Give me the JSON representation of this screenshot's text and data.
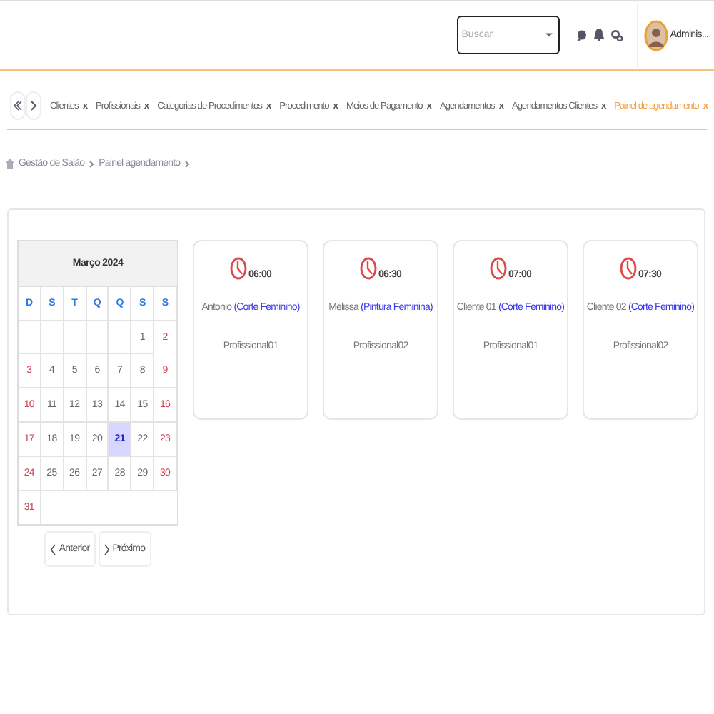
{
  "topbar": {
    "search": {
      "placeholder": "Buscar"
    },
    "user": "Adminis..."
  },
  "tabs": [
    {
      "label": "Clientes",
      "close": "x",
      "selected": false
    },
    {
      "label": "Profissionais",
      "close": "x",
      "selected": false
    },
    {
      "label": "Categorias de Procedimentos",
      "close": "x",
      "selected": false
    },
    {
      "label": "Procedimento",
      "close": "x",
      "selected": false
    },
    {
      "label": "Meios de Pagamento",
      "close": "x",
      "selected": false
    },
    {
      "label": "Agendamentos",
      "close": "x",
      "selected": false
    },
    {
      "label": "Agendamentos Clientes",
      "close": "x",
      "selected": false
    },
    {
      "label": "Painel de agendamento",
      "close": "x",
      "selected": true
    }
  ],
  "breadcrumb": [
    "Gestão de Salão",
    "Painel agendamento"
  ],
  "calendar": {
    "title": "Março 2024",
    "weekdays": [
      "D",
      "S",
      "T",
      "Q",
      "Q",
      "S",
      "S"
    ],
    "weeks": [
      [
        {
          "day": "1",
          "selected": false
        },
        {
          "day": "2",
          "selected": false
        }
      ],
      [
        {
          "day": "3",
          "selected": false
        },
        {
          "day": "4",
          "selected": false
        },
        {
          "day": "5",
          "selected": false
        },
        {
          "day": "6",
          "selected": false
        },
        {
          "day": "7",
          "selected": false
        },
        {
          "day": "8",
          "selected": false
        },
        {
          "day": "9",
          "selected": false
        }
      ],
      [
        {
          "day": "10",
          "selected": false
        },
        {
          "day": "11",
          "selected": false
        },
        {
          "day": "12",
          "selected": false
        },
        {
          "day": "13",
          "selected": false
        },
        {
          "day": "14",
          "selected": false
        },
        {
          "day": "15",
          "selected": false
        },
        {
          "day": "16",
          "selected": false
        }
      ],
      [
        {
          "day": "17",
          "selected": false
        },
        {
          "day": "18",
          "selected": false
        },
        {
          "day": "19",
          "selected": false
        },
        {
          "day": "20",
          "selected": false
        },
        {
          "day": "21",
          "selected": true
        },
        {
          "day": "22",
          "selected": false
        },
        {
          "day": "23",
          "selected": false
        }
      ],
      [
        {
          "day": "24",
          "selected": false
        },
        {
          "day": "25",
          "selected": false
        },
        {
          "day": "26",
          "selected": false
        },
        {
          "day": "27",
          "selected": false
        },
        {
          "day": "28",
          "selected": false
        },
        {
          "day": "29",
          "selected": false
        },
        {
          "day": "30",
          "selected": false
        }
      ],
      [
        {
          "day": "31",
          "selected": false
        }
      ]
    ],
    "prev": "Anterior",
    "next": "Próximo"
  },
  "appointments": [
    {
      "time": "06:00",
      "client": "Antonio",
      "service": "(Corte Feminino)",
      "professional": "Profissional01"
    },
    {
      "time": "06:30",
      "client": "Melissa",
      "service": "(Pintura Feminina)",
      "professional": "Profissional02"
    },
    {
      "time": "07:00",
      "client": "Cliente 01",
      "service": "(Corte Feminino)",
      "professional": "Profissional01"
    },
    {
      "time": "07:30",
      "client": "Cliente 02",
      "service": "(Corte Feminino)",
      "professional": "Profissional02"
    }
  ]
}
